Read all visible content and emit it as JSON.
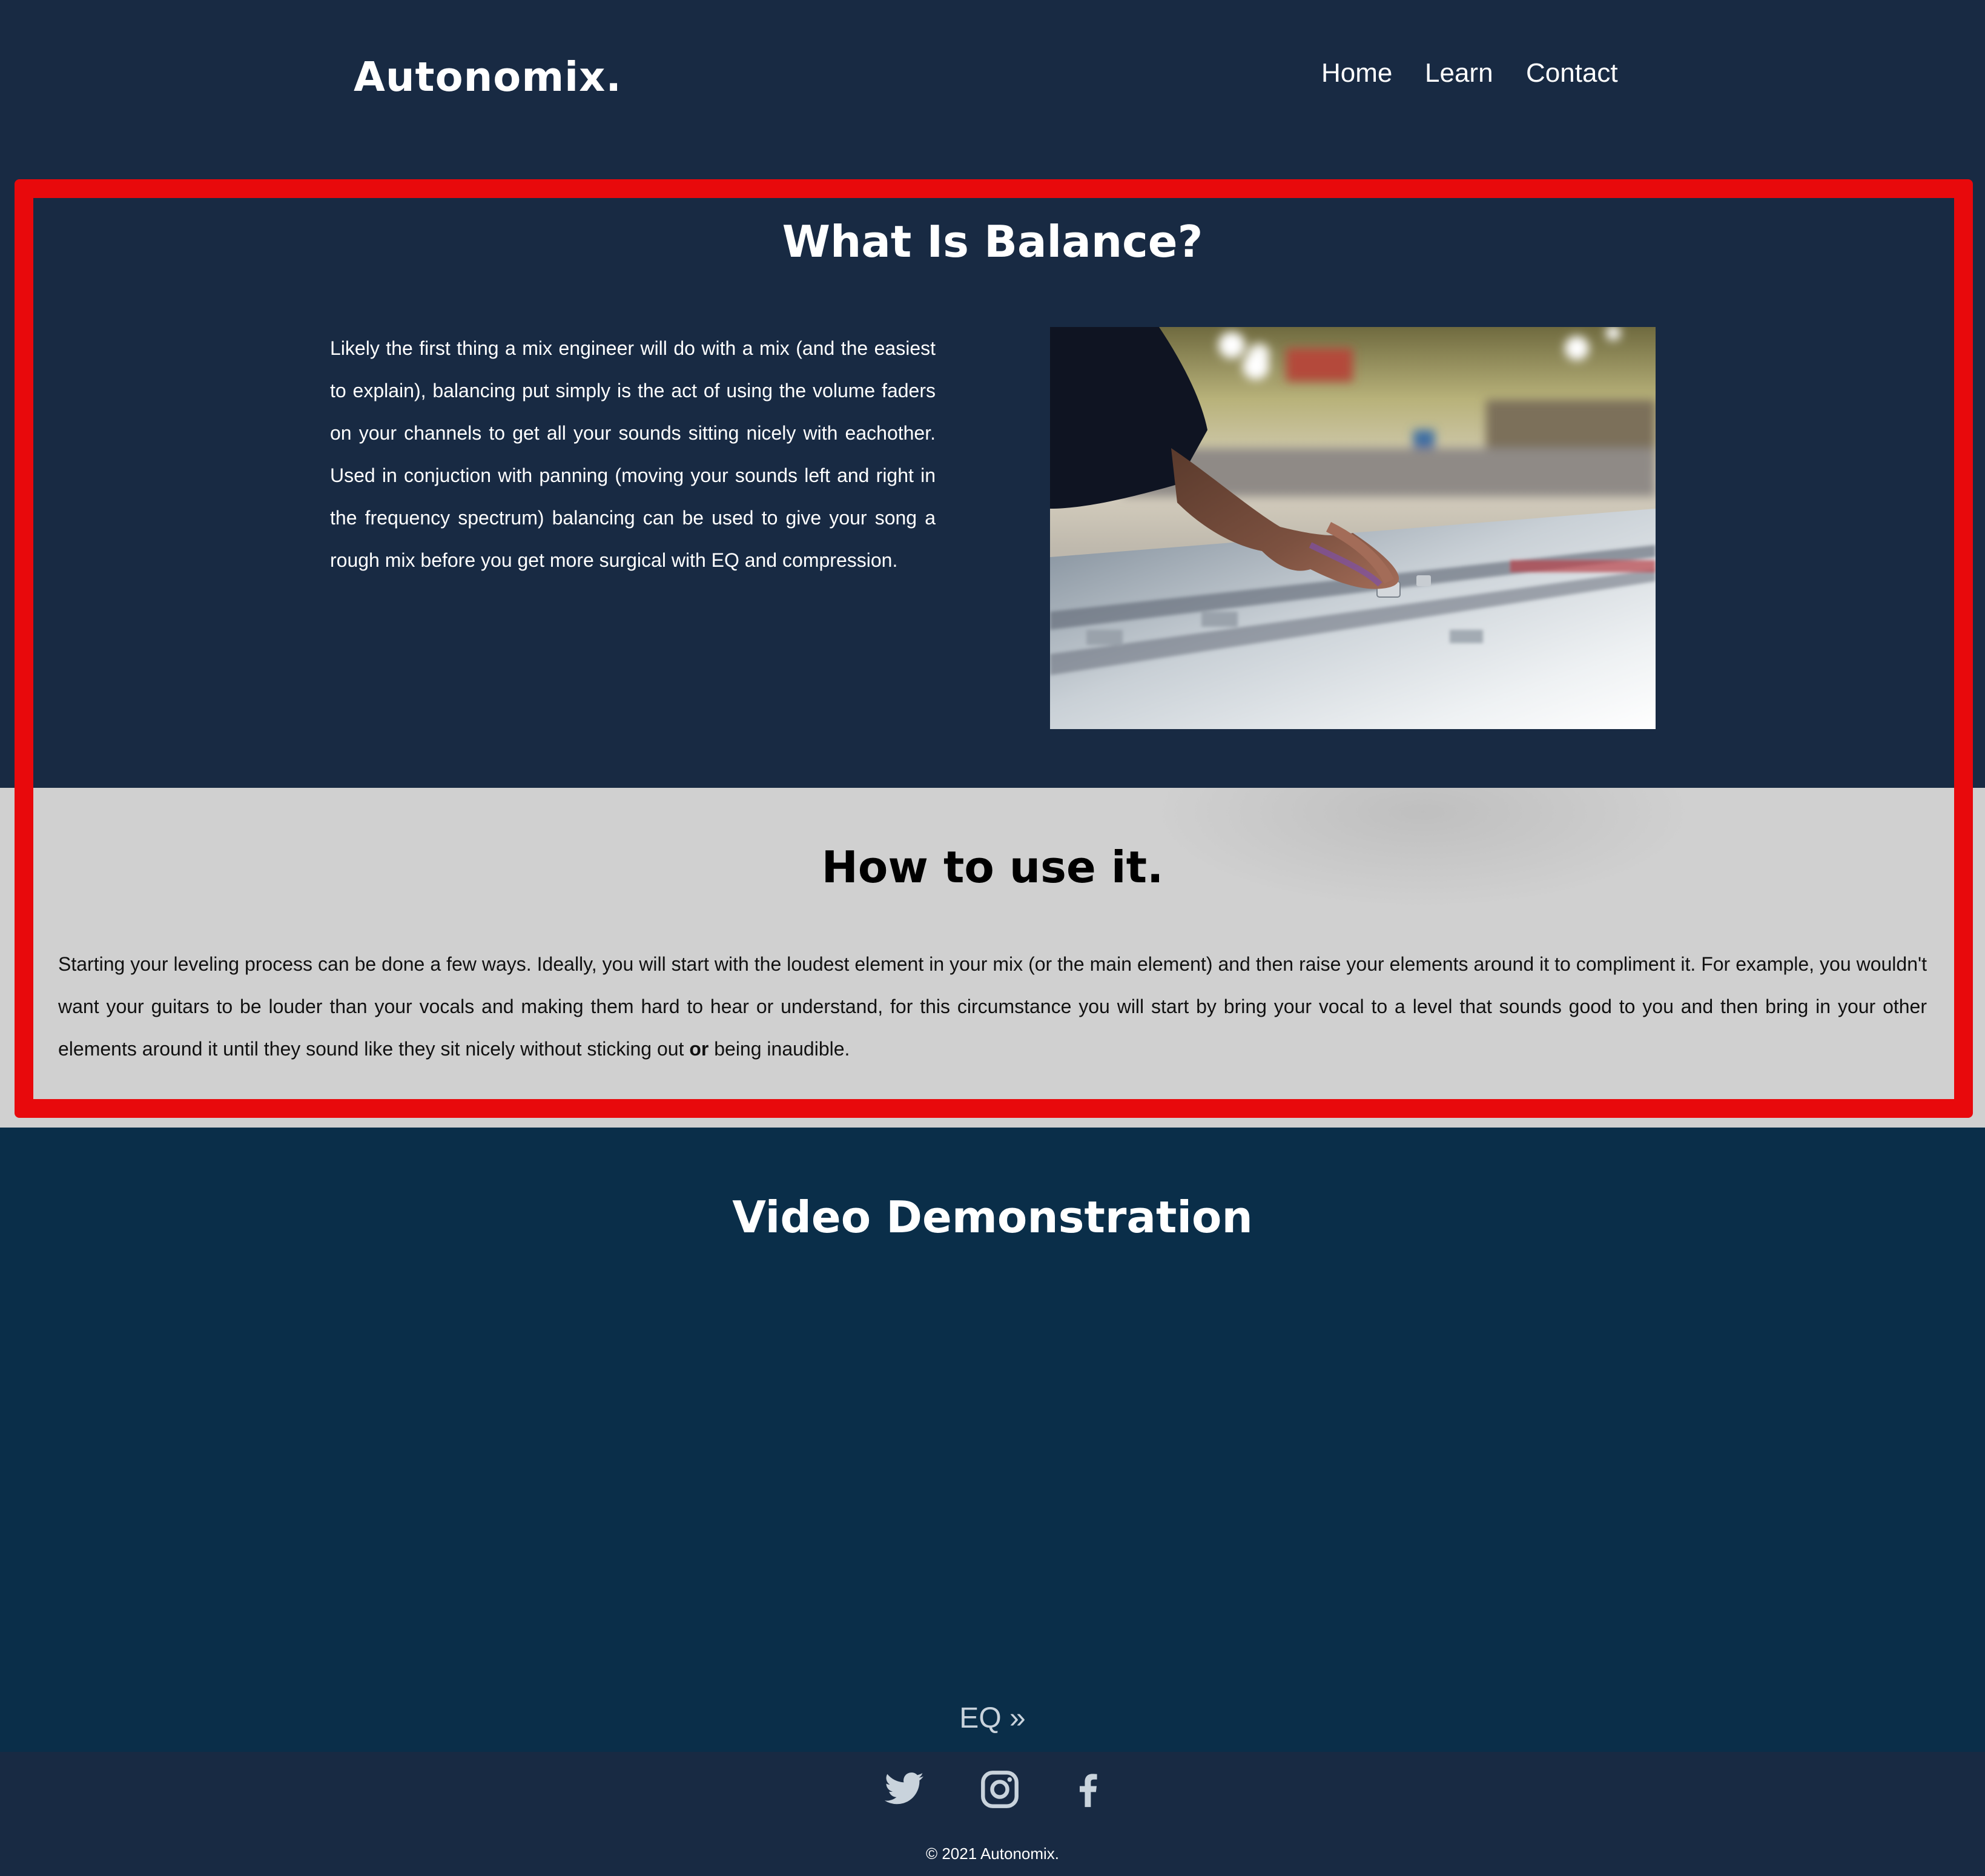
{
  "header": {
    "logo": "Autonomix.",
    "nav": [
      {
        "label": "Home"
      },
      {
        "label": "Learn"
      },
      {
        "label": "Contact"
      }
    ]
  },
  "balance": {
    "title": "What Is Balance?",
    "paragraph": "Likely the first thing a mix engineer will do with a mix (and the easiest to explain), balancing put simply is the act of using the volume faders on your channels to get all your sounds sitting nicely with eachother. Used in conjuction with panning (moving your sounds left and right in the frequency spectrum) balancing can be used to give your song a rough mix before you get more surgical with EQ and compression."
  },
  "howto": {
    "title": "How to use it.",
    "paragraph_before": "Starting your leveling process can be done a few ways. Ideally, you will start with the loudest element in your mix (or the main element) and then raise your elements around it to compliment it. For example, you wouldn't want your guitars to be louder than your vocals and making them hard to hear or understand, for this circumstance you will start by bring your vocal to a level that sounds good to you and then bring in your other elements around it until they sound like they sit nicely without sticking out ",
    "paragraph_bold": "or",
    "paragraph_after": " being inaudible."
  },
  "video": {
    "title": "Video Demonstration"
  },
  "next_link": {
    "label": "EQ »"
  },
  "footer": {
    "social_icons": [
      "twitter-icon",
      "instagram-icon",
      "facebook-icon"
    ],
    "copyright": "© 2021 Autonomix."
  },
  "colors": {
    "navy": "#182a43",
    "video_bg": "#0a2e49",
    "light_section": "#d0d0d0",
    "highlight_red": "#e8090c",
    "link_gray": "#c9d3dc"
  }
}
